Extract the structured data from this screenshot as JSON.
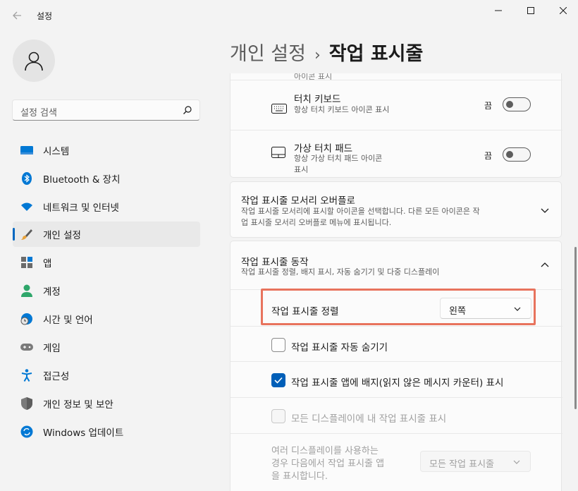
{
  "window": {
    "title": "설정"
  },
  "search": {
    "placeholder": "설정 검색"
  },
  "sidebar": {
    "items": [
      {
        "label": "시스템",
        "icon": "system-icon"
      },
      {
        "label": "Bluetooth & 장치",
        "icon": "bluetooth-icon"
      },
      {
        "label": "네트워크 및 인터넷",
        "icon": "wifi-icon"
      },
      {
        "label": "개인 설정",
        "icon": "brush-icon",
        "active": true
      },
      {
        "label": "앱",
        "icon": "apps-icon"
      },
      {
        "label": "계정",
        "icon": "account-icon"
      },
      {
        "label": "시간 및 언어",
        "icon": "globe-clock-icon"
      },
      {
        "label": "게임",
        "icon": "gamepad-icon"
      },
      {
        "label": "접근성",
        "icon": "accessibility-icon"
      },
      {
        "label": "개인 정보 및 보안",
        "icon": "shield-icon"
      },
      {
        "label": "Windows 업데이트",
        "icon": "update-icon"
      }
    ]
  },
  "header": {
    "parent": "개인 설정",
    "separator": "›",
    "current": "작업 표시줄"
  },
  "cut_row": {
    "sub": "아이콘 표시"
  },
  "touch_keyboard": {
    "title": "터치 키보드",
    "sub": "항상 터치 키보드 아이콘 표시",
    "state": "끔"
  },
  "touchpad": {
    "title": "가상 터치 패드",
    "sub1": "항상 가상 터치 패드 아이콘",
    "sub2": "표시",
    "state": "끔"
  },
  "overflow": {
    "title": "작업 표시줄 모서리 오버플로",
    "sub1": "작업 표시줄 모서리에 표시할 아이콘을 선택합니다. 다른 모든 아이콘은 작",
    "sub2": "업 표시줄 모서리 오버플로 메뉴에 표시됩니다."
  },
  "behaviors": {
    "title": "작업 표시줄 동작",
    "sub": "작업 표시줄 정렬, 배지 표시, 자동 숨기기 및 다중 디스플레이",
    "alignment": {
      "label": "작업 표시줄 정렬",
      "value": "왼쪽"
    },
    "autohide": {
      "label": "작업 표시줄 자동 숨기기",
      "checked": false
    },
    "badges": {
      "label": "작업 표시줄 앱에 배지(읽지 않은 메시지 카운터) 표시",
      "checked": true
    },
    "all_displays": {
      "label": "모든 디스플레이에 내 작업 표시줄 표시",
      "checked": false,
      "disabled": true
    },
    "multi": {
      "line1": "여러 디스플레이를 사용하는",
      "line2": "경우 다음에서 작업 표시줄 앱",
      "line3": "을 표시합니다.",
      "value": "모든 작업 표시줄"
    }
  },
  "colors": {
    "accent": "#005fb8",
    "highlight": "#e8735d"
  }
}
